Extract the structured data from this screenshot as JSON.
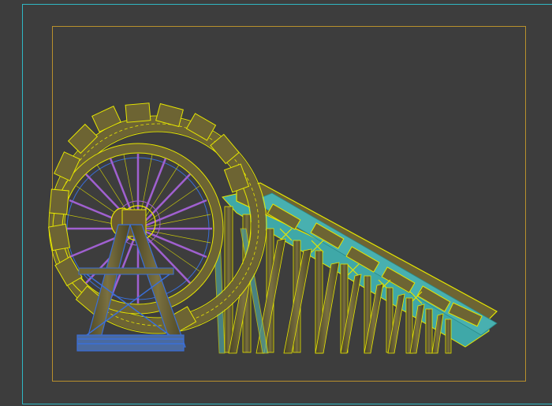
{
  "viewport": {
    "background": "#3d3d3d",
    "active_border_color": "#2fb7c4",
    "safe_frame_color": "#b8902c"
  },
  "model": {
    "wood_color": "#6d6433",
    "wood_dark": "#4a4424",
    "wire_yellow": "#e6e600",
    "wire_blue": "#3a6fd8",
    "wire_purple": "#a060d0",
    "water_cyan": "#3fb8b8",
    "axle_color": "#6b5a2e"
  }
}
